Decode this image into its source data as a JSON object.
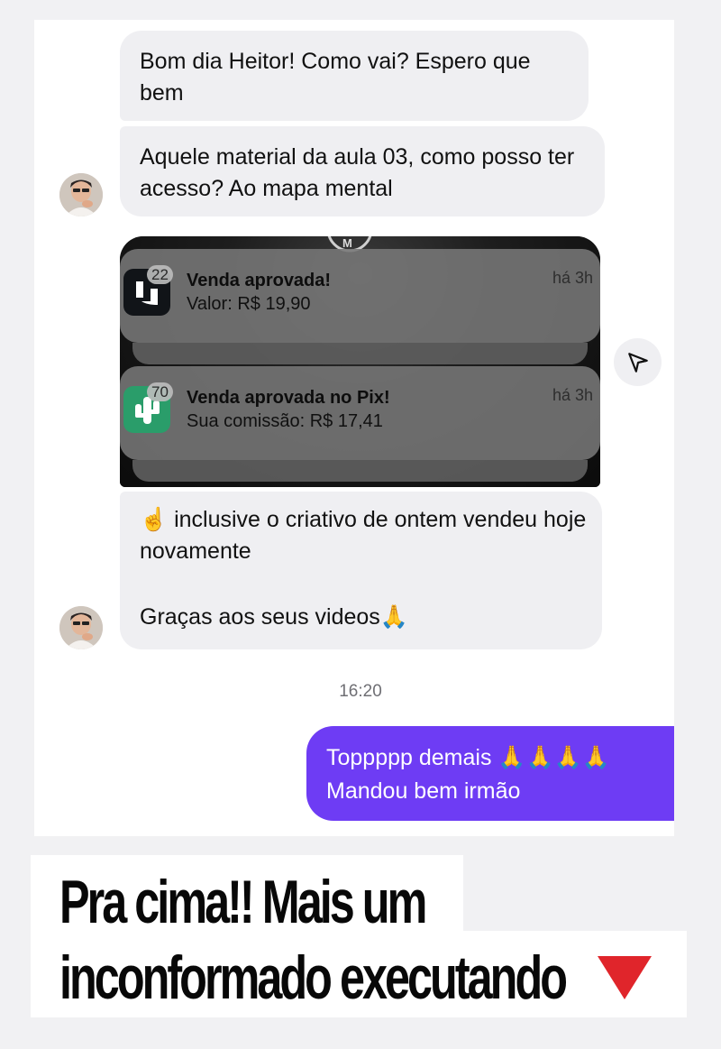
{
  "messages": {
    "in1": "Bom dia Heitor! Como vai? Espero que bem",
    "in2": "Aquele material da aula 03, como posso ter acesso? Ao mapa mental",
    "in3_line1": "☝️ inclusive o criativo de ontem vendeu hoje novamente",
    "in3_line2": "Graças aos seus videos🙏",
    "out_line1": "Toppppp demais 🙏🙏🙏🙏",
    "out_line2": "Mandou bem irmão"
  },
  "notifications": [
    {
      "badge": "22",
      "title": "Venda aprovada!",
      "body": "Valor: R$ 19,90",
      "time": "há 3h",
      "icon": "kiwify-app-icon",
      "icon_color": "#111418"
    },
    {
      "badge": "70",
      "title": "Venda aprovada no Pix!",
      "body": "Sua comissão: R$ 17,41",
      "time": "há 3h",
      "icon": "cactus-app-icon",
      "icon_color": "#2a9d6a"
    }
  ],
  "timestamp": "16:20",
  "caption": {
    "line1": "Pra cima!! Mais um",
    "line2": "inconformado executando"
  },
  "colors": {
    "outgoing_bubble": "#6e3cf4",
    "incoming_bubble": "#efeff2",
    "caption_arrow": "#e0252b"
  },
  "icons": [
    "send-icon",
    "avatar",
    "red-triangle-down-icon"
  ]
}
